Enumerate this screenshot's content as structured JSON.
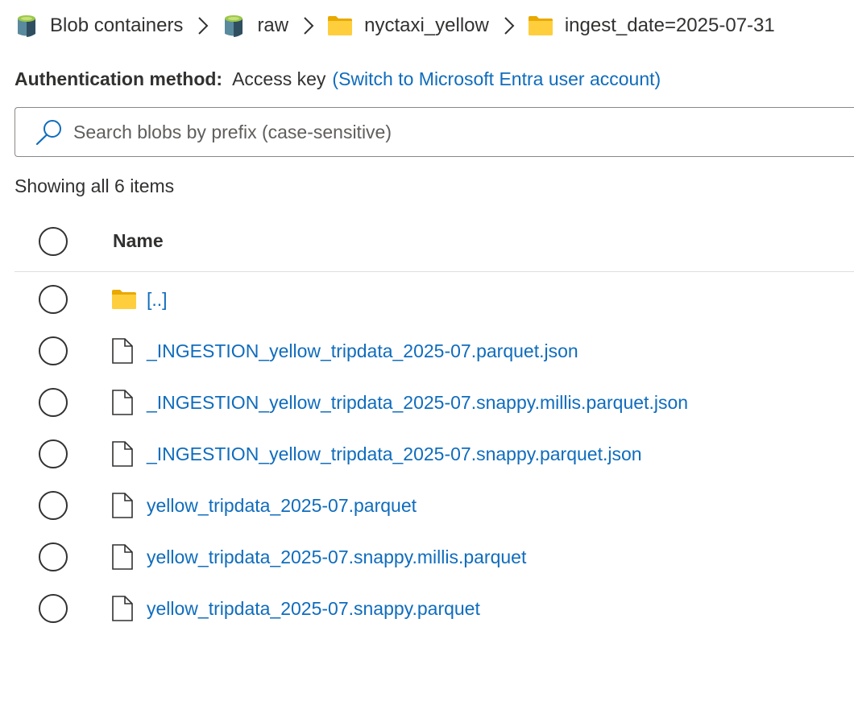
{
  "breadcrumb": {
    "items": [
      {
        "label": "Blob containers",
        "icon": "storage-container-icon"
      },
      {
        "label": "raw",
        "icon": "storage-container-icon"
      },
      {
        "label": "nyctaxi_yellow",
        "icon": "folder-icon"
      },
      {
        "label": "ingest_date=2025-07-31",
        "icon": "folder-icon"
      }
    ],
    "separator_icon": "chevron-right-icon"
  },
  "auth": {
    "label": "Authentication method:",
    "value": "Access key",
    "link": "(Switch to Microsoft Entra user account)"
  },
  "search": {
    "placeholder": "Search blobs by prefix (case-sensitive)",
    "value": "",
    "icon": "search-icon"
  },
  "summary": "Showing all 6 items",
  "table": {
    "header": {
      "name": "Name"
    },
    "rows": [
      {
        "name": "[..]",
        "icon": "folder-icon"
      },
      {
        "name": "_INGESTION_yellow_tripdata_2025-07.parquet.json",
        "icon": "file-icon"
      },
      {
        "name": "_INGESTION_yellow_tripdata_2025-07.snappy.millis.parquet.json",
        "icon": "file-icon"
      },
      {
        "name": "_INGESTION_yellow_tripdata_2025-07.snappy.parquet.json",
        "icon": "file-icon"
      },
      {
        "name": "yellow_tripdata_2025-07.parquet",
        "icon": "file-icon"
      },
      {
        "name": "yellow_tripdata_2025-07.snappy.millis.parquet",
        "icon": "file-icon"
      },
      {
        "name": "yellow_tripdata_2025-07.snappy.parquet",
        "icon": "file-icon"
      }
    ]
  },
  "colors": {
    "link": "#0f6cbd",
    "text": "#323130",
    "folder": "#f5c518",
    "divider": "#e1dfdd"
  }
}
